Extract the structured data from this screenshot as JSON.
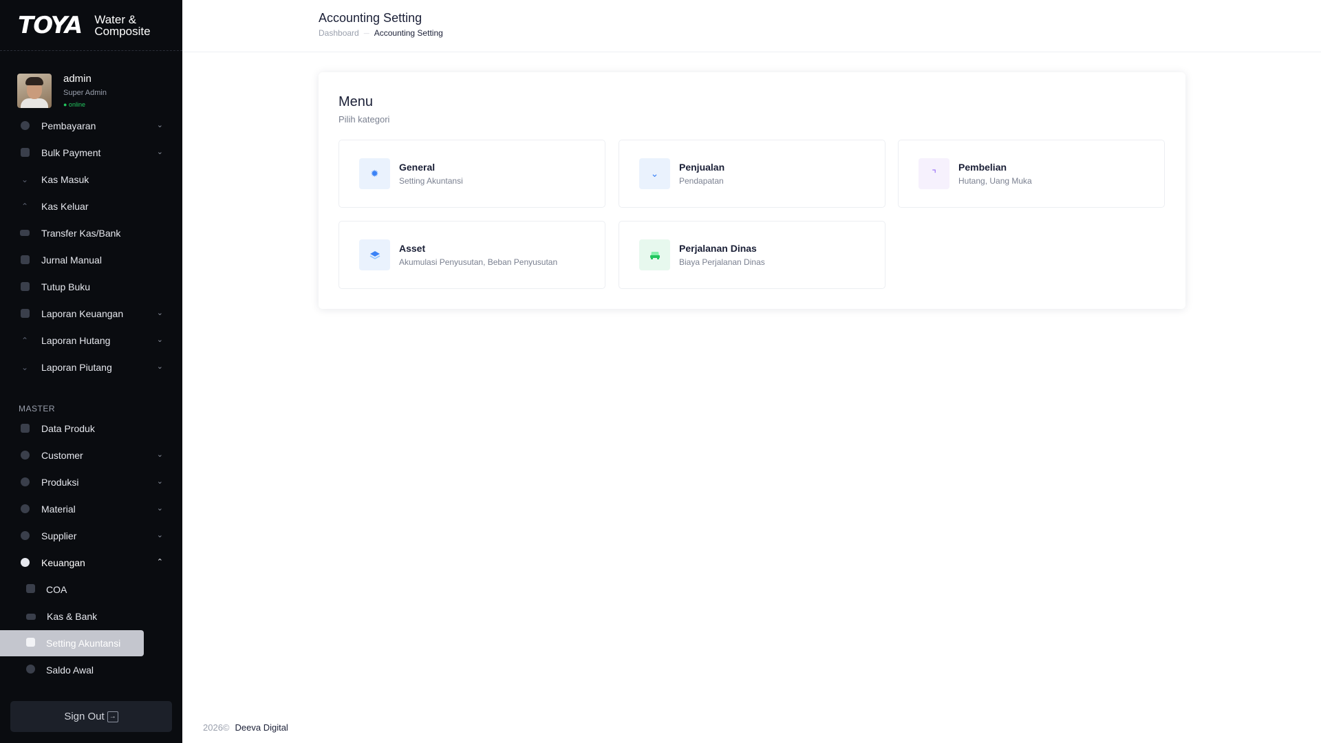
{
  "brand": {
    "logo": "TOYA",
    "line1": "Water &",
    "line2": "Composite"
  },
  "user": {
    "name": "admin",
    "role": "Super Admin",
    "status": "● online"
  },
  "sidebar": {
    "items": [
      {
        "label": "Pembayaran"
      },
      {
        "label": "Bulk Payment"
      },
      {
        "label": "Kas Masuk"
      },
      {
        "label": "Kas Keluar"
      },
      {
        "label": "Transfer Kas/Bank"
      },
      {
        "label": "Jurnal Manual"
      },
      {
        "label": "Tutup Buku"
      },
      {
        "label": "Laporan Keuangan"
      },
      {
        "label": "Laporan Hutang"
      },
      {
        "label": "Laporan Piutang"
      }
    ],
    "master_label": "MASTER",
    "master_items": [
      {
        "label": "Data Produk"
      },
      {
        "label": "Customer"
      },
      {
        "label": "Produksi"
      },
      {
        "label": "Material"
      },
      {
        "label": "Supplier"
      },
      {
        "label": "Keuangan"
      }
    ],
    "keuangan_sub": [
      {
        "label": "COA"
      },
      {
        "label": "Kas & Bank"
      },
      {
        "label": "Setting Akuntansi"
      },
      {
        "label": "Saldo Awal"
      }
    ],
    "signout": "Sign Out"
  },
  "header": {
    "title": "Accounting Setting",
    "breadcrumb": {
      "home": "Dashboard",
      "current": "Accounting Setting"
    }
  },
  "card": {
    "title": "Menu",
    "subtitle": "Pilih kategori",
    "tiles": [
      {
        "title": "General",
        "desc": "Setting Akuntansi",
        "icon": "gear-icon",
        "bg": "#eaf2fd",
        "fg": "#3b82f6"
      },
      {
        "title": "Penjualan",
        "desc": "Pendapatan",
        "icon": "arrow-down-icon",
        "bg": "#eaf2fd",
        "fg": "#3b82f6"
      },
      {
        "title": "Pembelian",
        "desc": "Hutang, Uang Muka",
        "icon": "arrow-up-icon",
        "bg": "#f6f1fd",
        "fg": "#8b5cf6"
      },
      {
        "title": "Asset",
        "desc": "Akumulasi Penyusutan, Beban Penyusutan",
        "icon": "layers-icon",
        "bg": "#eaf2fd",
        "fg": "#3b82f6"
      },
      {
        "title": "Perjalanan Dinas",
        "desc": "Biaya Perjalanan Dinas",
        "icon": "car-icon",
        "bg": "#e7f8ee",
        "fg": "#22c55e"
      }
    ]
  },
  "footer": {
    "year": "2026©",
    "brand": "Deeva Digital"
  }
}
